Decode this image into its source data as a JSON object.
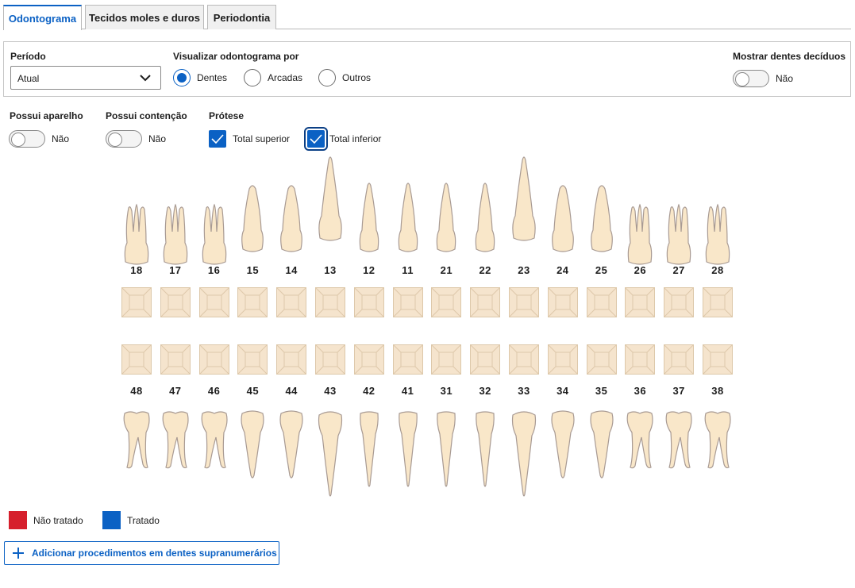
{
  "tabs": [
    {
      "label": "Odontograma",
      "active": true
    },
    {
      "label": "Tecidos moles e duros",
      "active": false
    },
    {
      "label": "Periodontia",
      "active": false
    }
  ],
  "filters": {
    "period_label": "Período",
    "period_value": "Atual",
    "view_by_label": "Visualizar odontograma por",
    "view_options": [
      "Dentes",
      "Arcadas",
      "Outros"
    ],
    "view_selected": "Dentes",
    "deciduous_label": "Mostrar dentes decíduos",
    "deciduous_value": "Não"
  },
  "options": {
    "appliance_label": "Possui aparelho",
    "appliance_value": "Não",
    "retainer_label": "Possui contenção",
    "retainer_value": "Não",
    "prosthesis_label": "Prótese",
    "prosthesis_items": [
      {
        "label": "Total superior",
        "checked": true
      },
      {
        "label": "Total inferior",
        "checked": true
      }
    ]
  },
  "odontogram": {
    "upper_teeth": [
      "18",
      "17",
      "16",
      "15",
      "14",
      "13",
      "12",
      "11",
      "21",
      "22",
      "23",
      "24",
      "25",
      "26",
      "27",
      "28"
    ],
    "lower_teeth": [
      "48",
      "47",
      "46",
      "45",
      "44",
      "43",
      "42",
      "41",
      "31",
      "32",
      "33",
      "34",
      "35",
      "36",
      "37",
      "38"
    ],
    "tooth_fill": "#f9e7c9",
    "tooth_stroke": "#a89a93",
    "surface_fill": "#f5e4cd",
    "surface_stroke": "#ddc8aa"
  },
  "legend": [
    {
      "label": "Não tratado",
      "color": "#d61f2c"
    },
    {
      "label": "Tratado",
      "color": "#0b61c4"
    }
  ],
  "actions": {
    "add_supernumerary_label": "Adicionar procedimentos em dentes supranumerários"
  },
  "colors": {
    "accent": "#0b61c4"
  }
}
